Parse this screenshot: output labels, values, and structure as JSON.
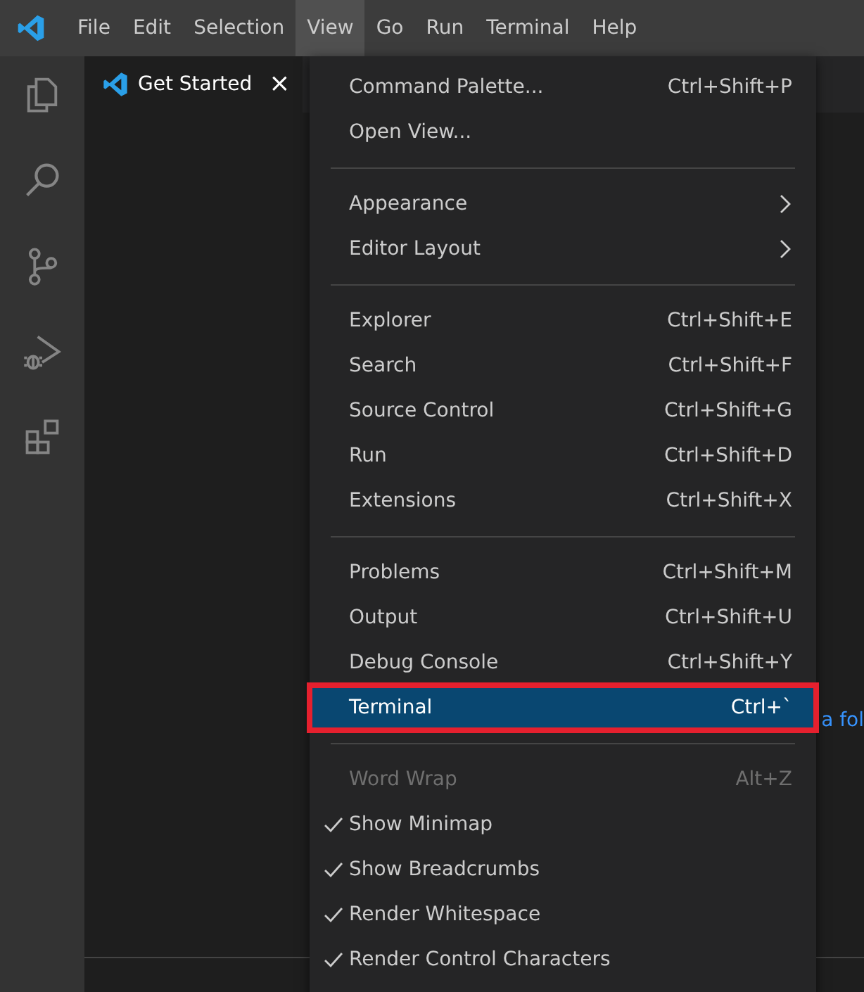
{
  "menubar": [
    {
      "label": "File",
      "selected": false
    },
    {
      "label": "Edit",
      "selected": false
    },
    {
      "label": "Selection",
      "selected": false
    },
    {
      "label": "View",
      "selected": true
    },
    {
      "label": "Go",
      "selected": false
    },
    {
      "label": "Run",
      "selected": false
    },
    {
      "label": "Terminal",
      "selected": false
    },
    {
      "label": "Help",
      "selected": false
    }
  ],
  "activity_bar": [
    {
      "kind": "explorer"
    },
    {
      "kind": "search"
    },
    {
      "kind": "source-control"
    },
    {
      "kind": "run-debug"
    },
    {
      "kind": "extensions"
    }
  ],
  "editor_tab": {
    "label": "Get Started",
    "close": "×"
  },
  "editor_text": "a fol",
  "view_menu": [
    [
      {
        "label": "Command Palette...",
        "shortcut": "Ctrl+Shift+P",
        "kind": "command",
        "checked": false,
        "disabled": false,
        "selected": false
      },
      {
        "label": "Open View...",
        "kind": "command",
        "checked": false,
        "disabled": false,
        "selected": false
      }
    ],
    [
      {
        "label": "Appearance",
        "kind": "submenu",
        "checked": false,
        "disabled": false,
        "selected": false
      },
      {
        "label": "Editor Layout",
        "kind": "submenu",
        "checked": false,
        "disabled": false,
        "selected": false
      }
    ],
    [
      {
        "label": "Explorer",
        "shortcut": "Ctrl+Shift+E",
        "kind": "command",
        "checked": false,
        "disabled": false,
        "selected": false
      },
      {
        "label": "Search",
        "shortcut": "Ctrl+Shift+F",
        "kind": "command",
        "checked": false,
        "disabled": false,
        "selected": false
      },
      {
        "label": "Source Control",
        "shortcut": "Ctrl+Shift+G",
        "kind": "command",
        "checked": false,
        "disabled": false,
        "selected": false
      },
      {
        "label": "Run",
        "shortcut": "Ctrl+Shift+D",
        "kind": "command",
        "checked": false,
        "disabled": false,
        "selected": false
      },
      {
        "label": "Extensions",
        "shortcut": "Ctrl+Shift+X",
        "kind": "command",
        "checked": false,
        "disabled": false,
        "selected": false
      }
    ],
    [
      {
        "label": "Problems",
        "shortcut": "Ctrl+Shift+M",
        "kind": "command",
        "checked": false,
        "disabled": false,
        "selected": false
      },
      {
        "label": "Output",
        "shortcut": "Ctrl+Shift+U",
        "kind": "command",
        "checked": false,
        "disabled": false,
        "selected": false
      },
      {
        "label": "Debug Console",
        "shortcut": "Ctrl+Shift+Y",
        "kind": "command",
        "checked": false,
        "disabled": false,
        "selected": false
      },
      {
        "label": "Terminal",
        "shortcut": "Ctrl+`",
        "kind": "command",
        "checked": false,
        "disabled": false,
        "selected": true,
        "highlighted": true
      }
    ],
    [
      {
        "label": "Word Wrap",
        "shortcut": "Alt+Z",
        "kind": "command",
        "checked": false,
        "disabled": true,
        "selected": false
      },
      {
        "label": "Show Minimap",
        "kind": "command",
        "checked": true,
        "disabled": false,
        "selected": false
      },
      {
        "label": "Show Breadcrumbs",
        "kind": "command",
        "checked": true,
        "disabled": false,
        "selected": false
      },
      {
        "label": "Render Whitespace",
        "kind": "command",
        "checked": true,
        "disabled": false,
        "selected": false
      },
      {
        "label": "Render Control Characters",
        "kind": "command",
        "checked": true,
        "disabled": false,
        "selected": false
      }
    ]
  ]
}
